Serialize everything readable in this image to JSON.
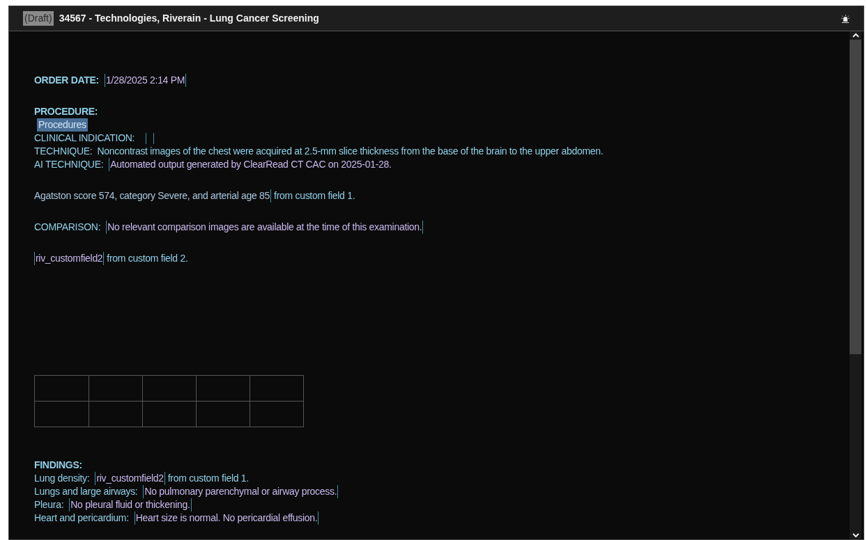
{
  "header": {
    "badge": "(Draft)",
    "title": "34567 - Technologies, Riverain - Lung Cancer Screening"
  },
  "blocks": [
    {
      "kind": "lines",
      "lines": [
        [
          {
            "kind": "heading",
            "text": "ORDER DATE:"
          },
          {
            "kind": "field",
            "text": "1/28/2025 2:14 PM"
          }
        ]
      ]
    },
    {
      "kind": "lines",
      "lines": [
        [
          {
            "kind": "heading",
            "text": "PROCEDURE:"
          }
        ],
        [
          {
            "kind": "selection",
            "text": "Procedures"
          }
        ],
        [
          {
            "kind": "label",
            "text": "CLINICAL INDICATION:"
          },
          {
            "kind": "field"
          }
        ],
        [
          {
            "kind": "label",
            "text": "TECHNIQUE:  Noncontrast images of the chest were acquired at 2.5-mm slice thickness from the base of the brain to the upper abdomen."
          }
        ],
        [
          {
            "kind": "label",
            "text": "AI TECHNIQUE:"
          },
          {
            "kind": "open_field",
            "text": "Automated output generated by ClearRead CT CAC on 2025-01-28."
          }
        ]
      ]
    },
    {
      "kind": "lines",
      "lines": [
        [
          {
            "kind": "close_field",
            "text": "Agatston score 574, category Severe, and arterial age 85"
          },
          {
            "kind": "label",
            "text": "from custom field 1."
          }
        ]
      ]
    },
    {
      "kind": "lines",
      "lines": [
        [
          {
            "kind": "label",
            "text": "COMPARISON:"
          },
          {
            "kind": "field",
            "text": "No relevant comparison images are available at the time of this examination."
          }
        ]
      ]
    },
    {
      "kind": "lines",
      "lines": [
        [
          {
            "kind": "field",
            "text": "riv_customfield2"
          },
          {
            "kind": "label",
            "text": "from custom field 2."
          }
        ]
      ]
    },
    {
      "kind": "table"
    },
    {
      "kind": "lines",
      "lines": [
        [
          {
            "kind": "heading",
            "text": "FINDINGS:"
          }
        ],
        [
          {
            "kind": "label",
            "text": "Lung density:"
          },
          {
            "kind": "field",
            "text": "riv_customfield2"
          },
          {
            "kind": "label",
            "text": "from custom field 1."
          }
        ],
        [
          {
            "kind": "label",
            "text": "Lungs and large airways:"
          },
          {
            "kind": "field",
            "text": "No pulmonary parenchymal or airway process."
          }
        ],
        [
          {
            "kind": "label",
            "text": "Pleura:"
          },
          {
            "kind": "field",
            "text": "No pleural fluid or thickening."
          }
        ],
        [
          {
            "kind": "label",
            "text": "Heart and pericardium:"
          },
          {
            "kind": "field",
            "text": "Heart size is normal. No pericardial effusion."
          }
        ]
      ]
    }
  ]
}
